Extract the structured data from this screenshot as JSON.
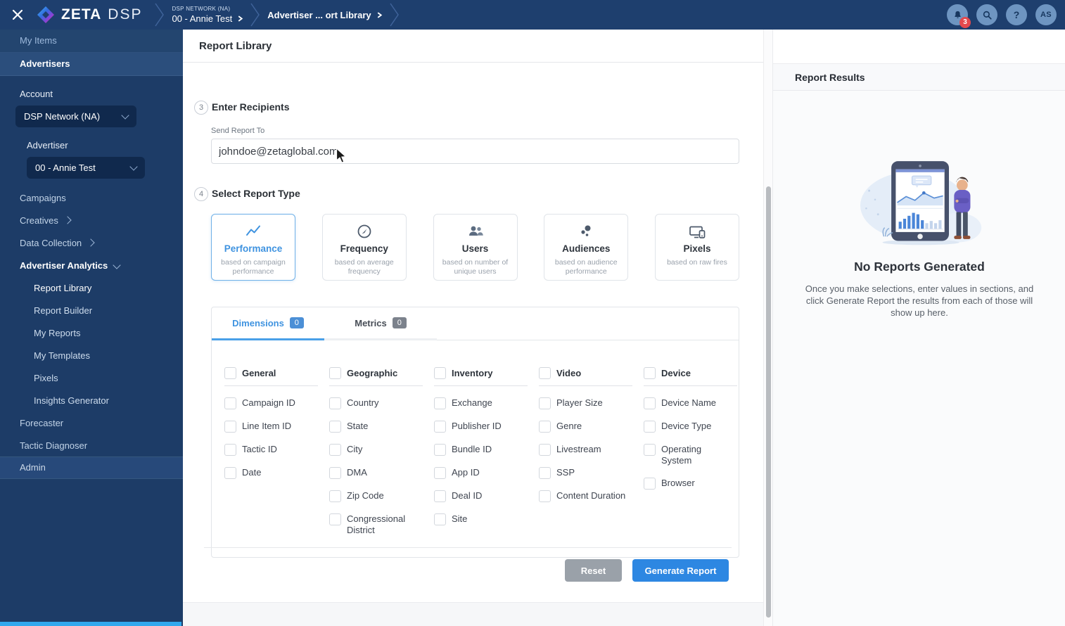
{
  "topbar": {
    "brand": {
      "zeta": "ZETA",
      "dsp": "DSP"
    },
    "breadcrumbs": [
      {
        "eyebrow": "DSP NETWORK (NA)",
        "label": "00 - Annie Test"
      },
      {
        "eyebrow": "",
        "label": "Advertiser ... ort Library"
      }
    ],
    "notification_count": "3",
    "help_label": "?",
    "avatar_initials": "AS"
  },
  "sidebar": {
    "my_items_label": "My Items",
    "advertisers_label": "Advertisers",
    "account_label": "Account",
    "account_value": "DSP Network (NA)",
    "advertiser_label": "Advertiser",
    "advertiser_value": "00 - Annie Test",
    "nav": [
      {
        "label": "Campaigns",
        "type": "item"
      },
      {
        "label": "Creatives",
        "type": "item",
        "chevron": "right"
      },
      {
        "label": "Data Collection",
        "type": "item",
        "chevron": "right"
      },
      {
        "label": "Advertiser Analytics",
        "type": "item",
        "chevron": "down",
        "expanded": true
      },
      {
        "label": "Report Library",
        "type": "subitem",
        "active": true
      },
      {
        "label": "Report Builder",
        "type": "subitem"
      },
      {
        "label": "My Reports",
        "type": "subitem"
      },
      {
        "label": "My Templates",
        "type": "subitem"
      },
      {
        "label": "Pixels",
        "type": "subitem"
      },
      {
        "label": "Insights Generator",
        "type": "subitem"
      },
      {
        "label": "Forecaster",
        "type": "item"
      },
      {
        "label": "Tactic Diagnoser",
        "type": "item"
      }
    ],
    "admin_label": "Admin"
  },
  "main": {
    "page_title": "Report Library",
    "steps": {
      "recipients": {
        "number": "3",
        "title": "Enter Recipients",
        "field_label": "Send Report To",
        "field_value": "johndoe@zetaglobal.com"
      },
      "report_type": {
        "number": "4",
        "title": "Select Report Type"
      }
    },
    "report_types": [
      {
        "label": "Performance",
        "description": "based on campaign performance",
        "icon": "line-chart",
        "selected": true
      },
      {
        "label": "Frequency",
        "description": "based on average frequency",
        "icon": "gauge",
        "selected": false
      },
      {
        "label": "Users",
        "description": "based on number of unique users",
        "icon": "users",
        "selected": false
      },
      {
        "label": "Audiences",
        "description": "based on audience performance",
        "icon": "dots",
        "selected": false
      },
      {
        "label": "Pixels",
        "description": "based on raw fires",
        "icon": "devices",
        "selected": false
      }
    ],
    "tabs": [
      {
        "label": "Dimensions",
        "count": "0",
        "active": true
      },
      {
        "label": "Metrics",
        "count": "0",
        "active": false
      }
    ],
    "dimension_groups": [
      {
        "name": "General",
        "items": [
          "Campaign ID",
          "Line Item ID",
          "Tactic ID",
          "Date"
        ]
      },
      {
        "name": "Geographic",
        "items": [
          "Country",
          "State",
          "City",
          "DMA",
          "Zip Code",
          "Congressional\nDistrict"
        ]
      },
      {
        "name": "Inventory",
        "items": [
          "Exchange",
          "Publisher ID",
          "Bundle ID",
          "App ID",
          "Deal ID",
          "Site"
        ]
      },
      {
        "name": "Video",
        "items": [
          "Player Size",
          "Genre",
          "Livestream",
          "SSP",
          "Content Duration"
        ]
      },
      {
        "name": "Device",
        "items": [
          "Device Name",
          "Device Type",
          "Operating\nSystem",
          "Browser"
        ]
      }
    ],
    "actions": {
      "reset": "Reset",
      "generate": "Generate Report"
    }
  },
  "results_panel": {
    "title": "Report Results",
    "empty_title": "No Reports Generated",
    "empty_text": "Once you make selections, enter values in sections, and click Generate Report the results from each of those will show up here."
  },
  "colors": {
    "accent_blue": "#2d87e2",
    "navy_topbar": "#1e3f6e",
    "navy_sidebar": "#1d3c67",
    "badge_red": "#e4494d",
    "cyan_strip": "#31a8ee",
    "reset_gray": "#9aa1a9"
  }
}
